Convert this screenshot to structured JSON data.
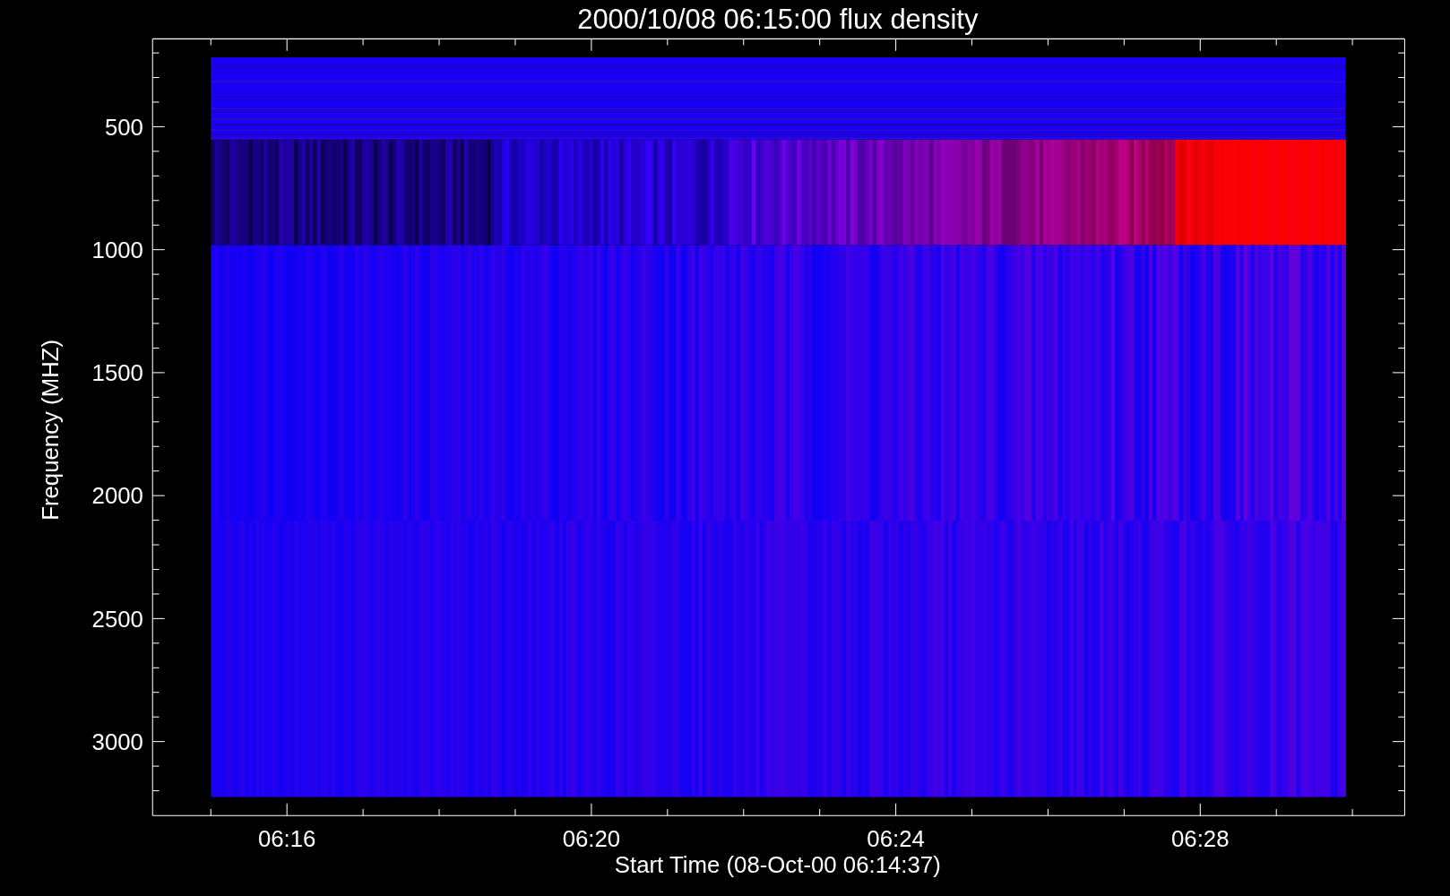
{
  "plot": {
    "title": "2000/10/08 06:15:00 flux density",
    "xlabel": "Start Time (08-Oct-00 06:14:37)",
    "ylabel": "Frequency (MHZ)",
    "xtick_labels": [
      "06:16",
      "06:20",
      "06:24",
      "06:28"
    ],
    "ytick_labels": [
      "500",
      "1000",
      "1500",
      "2000",
      "2500",
      "3000"
    ]
  }
}
